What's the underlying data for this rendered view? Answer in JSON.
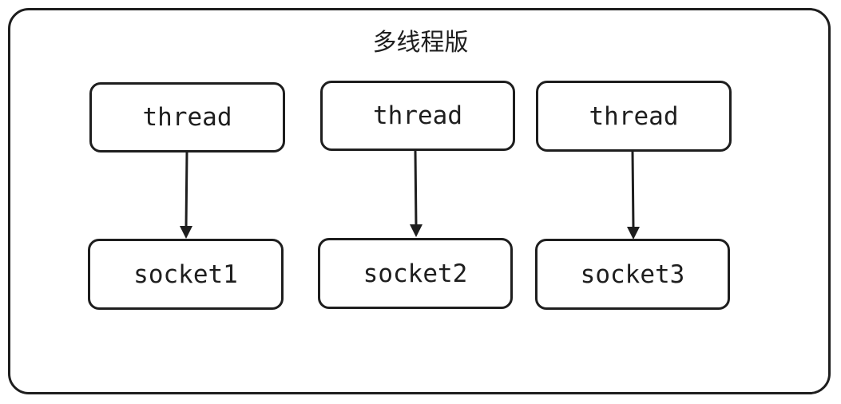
{
  "diagram": {
    "title": "多线程版",
    "columns": [
      {
        "thread_label": "thread",
        "socket_label": "socket1"
      },
      {
        "thread_label": "thread",
        "socket_label": "socket2"
      },
      {
        "thread_label": "thread",
        "socket_label": "socket3"
      }
    ],
    "stroke_color": "#1e1e1e",
    "background_color": "#ffffff"
  }
}
